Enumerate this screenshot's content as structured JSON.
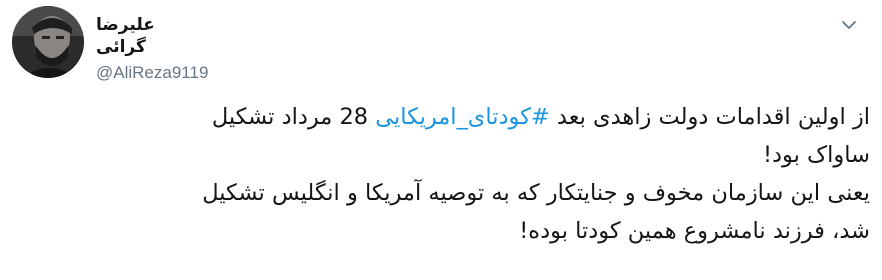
{
  "tweet": {
    "display_name": "علیرضا گرائی",
    "handle": "@AliReza9119",
    "caret_icon": "chevron-down-icon",
    "lines": {
      "l1_before": "از اولین اقدامات دولت زاهدی بعد ",
      "hashtag": "#کودتای_امریکایی",
      "l1_after": " 28 مرداد تشکیل",
      "l2": "ساواک بود!",
      "l3": "یعنی این سازمان مخوف و جنایتکار که به توصیه آمریکا و انگلیس تشکیل",
      "l4": "شد، فرزند نامشروع همین کودتا بوده!"
    },
    "colors": {
      "text": "#14171a",
      "secondary": "#657786",
      "link": "#1b95e0"
    }
  }
}
